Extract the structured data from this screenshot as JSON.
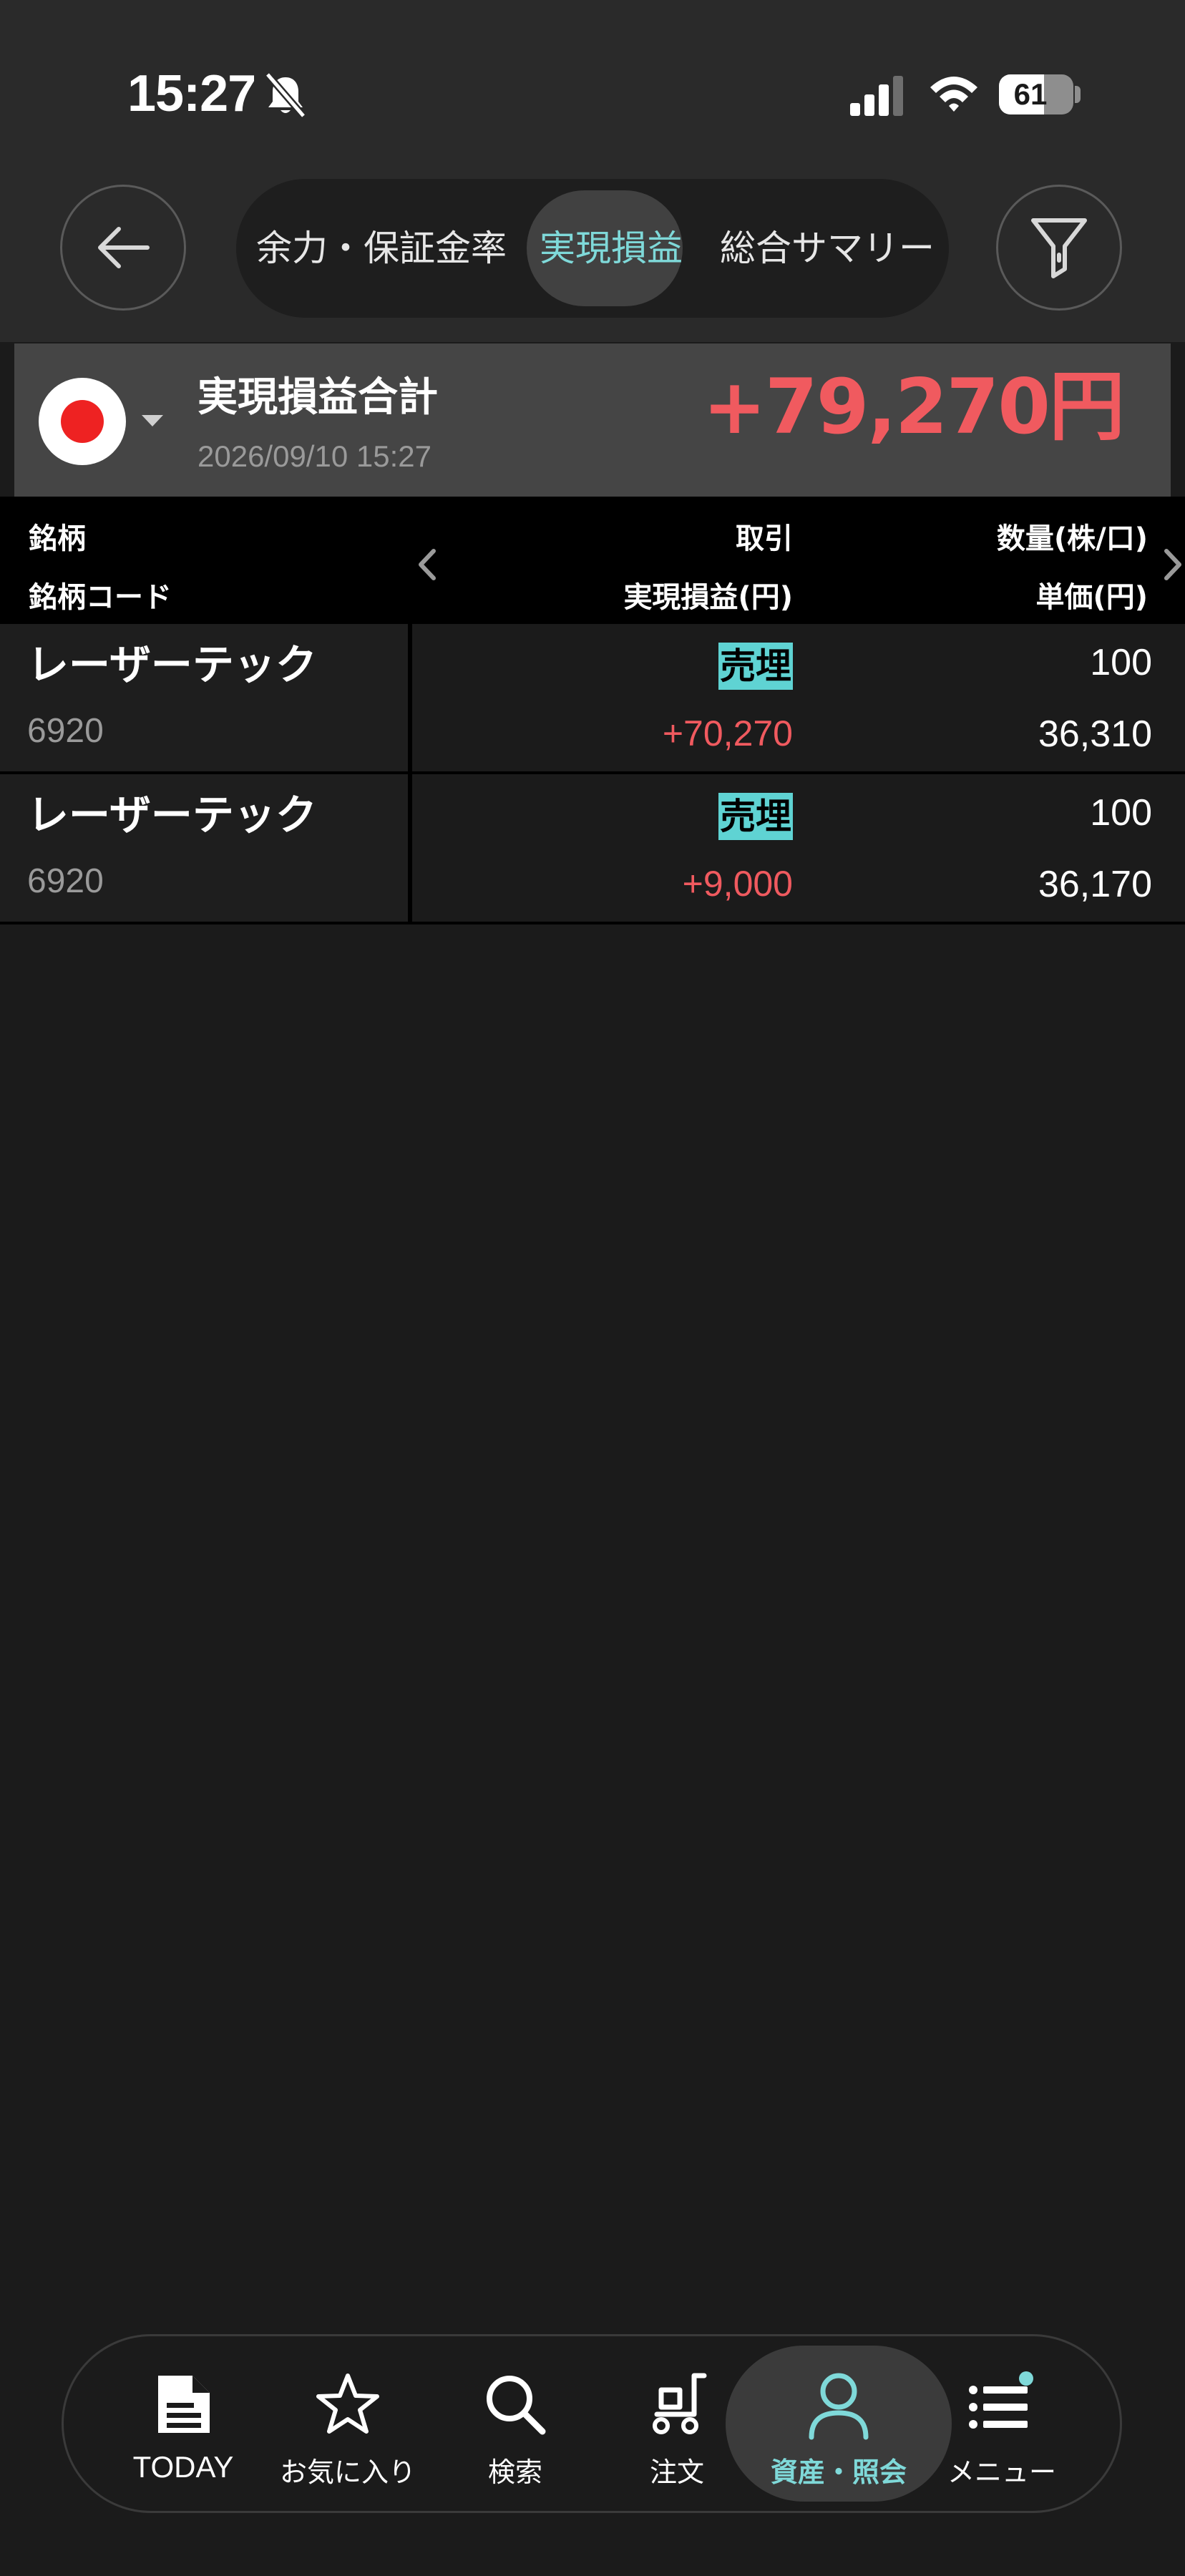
{
  "status_bar": {
    "time": "15:27",
    "battery": "61",
    "battery_level": 0.61
  },
  "header": {
    "tabs": [
      {
        "label": "余力・保証金率",
        "active": false
      },
      {
        "label": "実現損益",
        "active": true
      },
      {
        "label": "総合サマリー",
        "active": false
      }
    ]
  },
  "summary": {
    "title": "実現損益合計",
    "timestamp": "2026/09/10 15:27",
    "amount": "+79,270円"
  },
  "columns": {
    "name": "銘柄",
    "code": "銘柄コード",
    "trade": "取引",
    "realized_pl": "実現損益(円)",
    "quantity": "数量(株/口)",
    "unit_price": "単価(円)"
  },
  "rows": [
    {
      "name": "レーザーテック",
      "code": "6920",
      "trade": "売埋",
      "pl": "+70,270",
      "qty": "100",
      "price": "36,310"
    },
    {
      "name": "レーザーテック",
      "code": "6920",
      "trade": "売埋",
      "pl": "+9,000",
      "qty": "100",
      "price": "36,170"
    }
  ],
  "bottom_nav": {
    "items": [
      {
        "label": "TODAY",
        "icon": "document-icon"
      },
      {
        "label": "お気に入り",
        "icon": "star-icon"
      },
      {
        "label": "検索",
        "icon": "search-icon"
      },
      {
        "label": "注文",
        "icon": "cart-icon"
      },
      {
        "label": "資産・照会",
        "icon": "person-icon",
        "active": true
      },
      {
        "label": "メニュー",
        "icon": "list-icon"
      }
    ]
  },
  "colors": {
    "accent": "#7fd9d9",
    "profit": "#f05a5f",
    "trade_badge": "#5fd3d3",
    "background": "#1b1b1b"
  }
}
